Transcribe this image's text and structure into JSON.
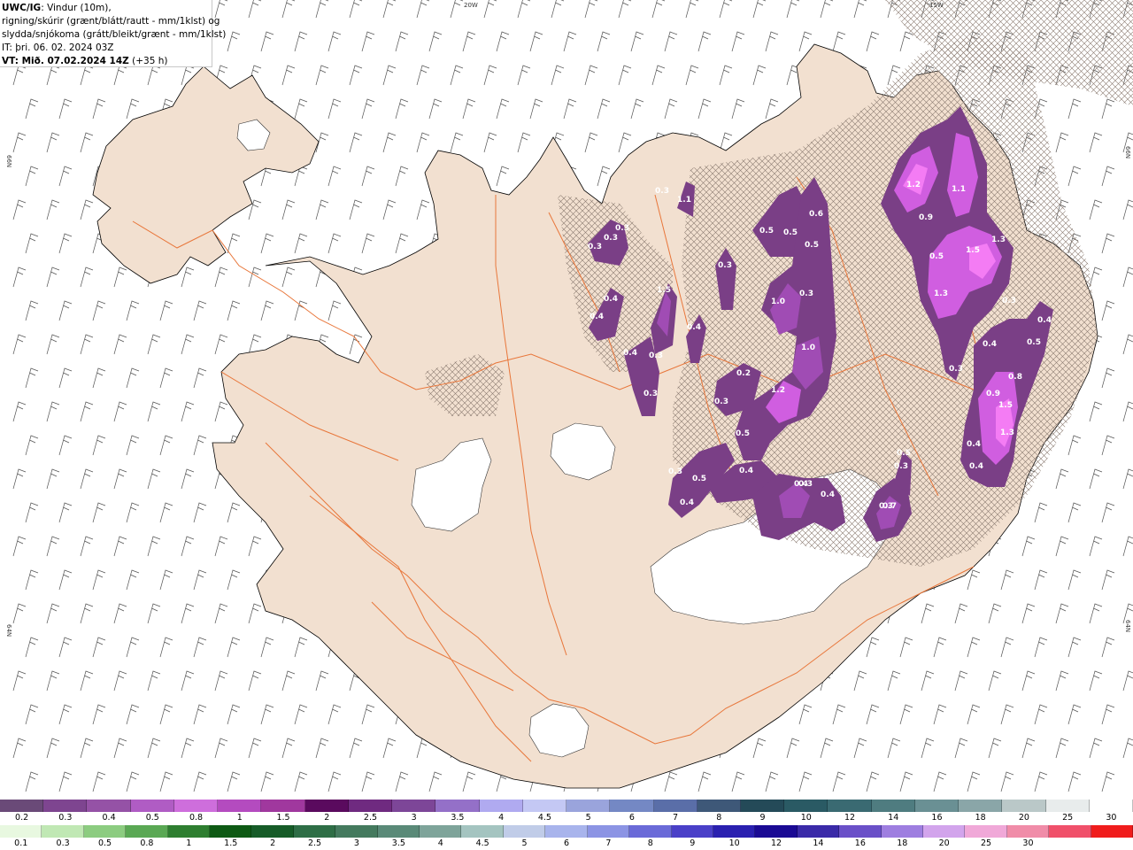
{
  "header": {
    "title_bold": "UWC/IG",
    "title_rest": ": Vindur (10m),",
    "line2": "rigning/skúrir (grænt/blátt/rautt - mm/1klst) og",
    "line3": "slydda/snjókoma (grátt/bleikt/grænt - mm/1klst)",
    "line4": "IT: þri. 06. 02. 2024 03Z",
    "line5_bold": "VT: Mið. 07.02.2024 14Z",
    "line5_rest": " (+35 h)"
  },
  "grid_labels": {
    "top_20w": "20W",
    "top_15w": "15W",
    "left_66n": "66N",
    "right_66n": "66N",
    "left_64n": "64N",
    "right_64n": "64N"
  },
  "colors": {
    "sea": "#ffffff",
    "land": "#f2e0d0",
    "coast": "#000000",
    "roads": "#e8763a",
    "precip_light": "#7a3f86",
    "precip_mid": "#a04cb4",
    "precip_high": "#d05ee0",
    "precip_peak": "#f47cf4",
    "glacier": "#ffffff"
  },
  "precip_values": [
    {
      "v": "0.3"
    },
    {
      "v": "0.3"
    },
    {
      "v": "0.3"
    },
    {
      "v": "0.3"
    },
    {
      "v": "0.4"
    },
    {
      "v": "0.4"
    },
    {
      "v": "0.4"
    },
    {
      "v": "0.3"
    },
    {
      "v": "0.3"
    },
    {
      "v": "1.1"
    },
    {
      "v": "0.4"
    },
    {
      "v": "1.5"
    },
    {
      "v": "0.3"
    },
    {
      "v": "0.5"
    },
    {
      "v": "0.6"
    },
    {
      "v": "0.5"
    },
    {
      "v": "0.5"
    },
    {
      "v": "1.0"
    },
    {
      "v": "0.3"
    },
    {
      "v": "1.0"
    },
    {
      "v": "0.2"
    },
    {
      "v": "0.3"
    },
    {
      "v": "1.2"
    },
    {
      "v": "0.5"
    },
    {
      "v": "0.3"
    },
    {
      "v": "0.5"
    },
    {
      "v": "0.4"
    },
    {
      "v": "0.4"
    },
    {
      "v": "0.4"
    },
    {
      "v": "0.4"
    },
    {
      "v": "0.5"
    },
    {
      "v": "0.3"
    },
    {
      "v": "0.3"
    },
    {
      "v": "0.3"
    },
    {
      "v": "0.7"
    },
    {
      "v": "1.2"
    },
    {
      "v": "1.1"
    },
    {
      "v": "0.9"
    },
    {
      "v": "0.5"
    },
    {
      "v": "1.3"
    },
    {
      "v": "1.5"
    },
    {
      "v": "1.3"
    },
    {
      "v": "0.3"
    },
    {
      "v": "0.3"
    },
    {
      "v": "0.4"
    },
    {
      "v": "0.5"
    },
    {
      "v": "0.4"
    },
    {
      "v": "0.9"
    },
    {
      "v": "0.8"
    },
    {
      "v": "1.5"
    },
    {
      "v": "1.3"
    },
    {
      "v": "0.4"
    },
    {
      "v": "0.4"
    }
  ],
  "legend_snow": {
    "colors": [
      "#6a4a78",
      "#7e4590",
      "#9552a6",
      "#b05cc4",
      "#ce6edc",
      "#b44bbf",
      "#a0389e",
      "#5a0a5e",
      "#6f2a80",
      "#7d4698",
      "#9470c8",
      "#b0aaf0",
      "#c4c8f4",
      "#9aa4dc",
      "#7488c4",
      "#5a6ea8",
      "#3e5878",
      "#244a58",
      "#2a5a64",
      "#3a6a72",
      "#4f7c80",
      "#6a9094",
      "#8aa6a8",
      "#bac8c8",
      "#e8ecec",
      "#ffffff"
    ],
    "labels": [
      "0.2",
      "0.3",
      "0.4",
      "0.5",
      "0.8",
      "1",
      "1.5",
      "2",
      "2.5",
      "3",
      "3.5",
      "4",
      "4.5",
      "5",
      "6",
      "7",
      "8",
      "9",
      "10",
      "12",
      "14",
      "16",
      "18",
      "20",
      "25",
      "30"
    ]
  },
  "legend_rain": {
    "colors": [
      "#e8f8e0",
      "#c0e8b4",
      "#8ccc80",
      "#5aa854",
      "#2e7e30",
      "#0e5a14",
      "#165c28",
      "#2e6e46",
      "#447a5e",
      "#5a8a78",
      "#7ea49a",
      "#a4c4c0",
      "#c0cce8",
      "#a8b4ec",
      "#8c94e4",
      "#6a6ad8",
      "#4a40c8",
      "#2a20b0",
      "#1a0a94",
      "#3a2aa8",
      "#6a50c8",
      "#9e7ee0",
      "#d2a4ec",
      "#f0a8d8",
      "#f08ca8",
      "#f0506a",
      "#f01c1c"
    ],
    "labels": [
      "0.1",
      "0.3",
      "0.5",
      "0.8",
      "1",
      "1.5",
      "2",
      "2.5",
      "3",
      "3.5",
      "4",
      "4.5",
      "5",
      "6",
      "7",
      "8",
      "9",
      "10",
      "12",
      "14",
      "16",
      "18",
      "20",
      "25",
      "30"
    ]
  }
}
